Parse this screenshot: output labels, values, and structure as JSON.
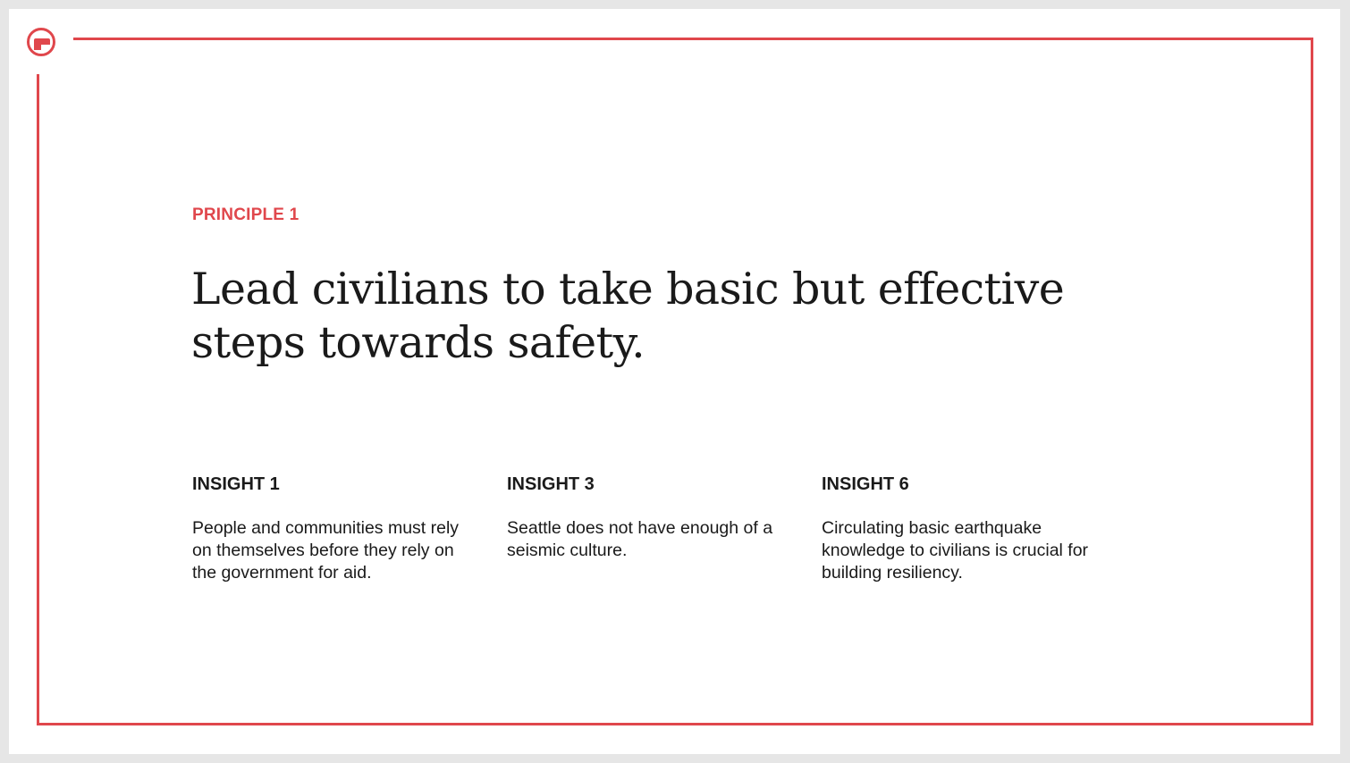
{
  "slide": {
    "eyebrow": "PRINCIPLE 1",
    "headline": "Lead civilians to take basic but effective steps towards safety.",
    "insights": [
      {
        "title": "INSIGHT 1",
        "body": "People and communities must rely on themselves before they rely on the government for aid."
      },
      {
        "title": "INSIGHT 3",
        "body": "Seattle does not have enough of a seismic culture."
      },
      {
        "title": "INSIGHT 6",
        "body": "Circulating basic earthquake knowledge to civilians is crucial for building resiliency."
      }
    ]
  },
  "logo": {
    "icon": "circle-door-logo-icon"
  },
  "colors": {
    "accent": "#e0474c",
    "text": "#1a1a1a",
    "background": "#ffffff",
    "outer_background": "#e6e6e6"
  }
}
